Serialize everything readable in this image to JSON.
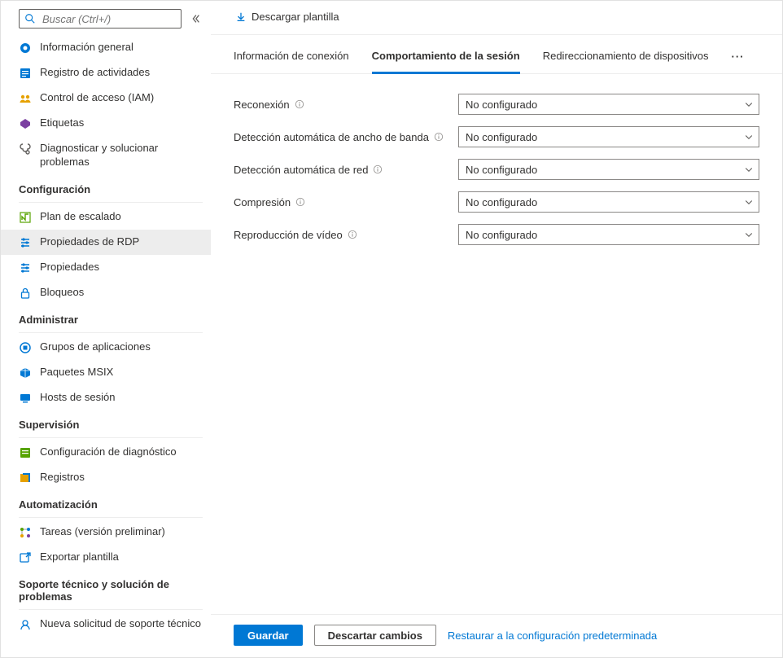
{
  "search": {
    "placeholder": "Buscar (Ctrl+/)"
  },
  "sidebar": {
    "top_items": [
      {
        "label": "Información general",
        "icon": "overview"
      },
      {
        "label": "Registro de actividades",
        "icon": "activity-log"
      },
      {
        "label": "Control de acceso (IAM)",
        "icon": "access"
      },
      {
        "label": "Etiquetas",
        "icon": "tag"
      },
      {
        "label": "Diagnosticar y solucionar problemas",
        "icon": "diagnose"
      }
    ],
    "sections": [
      {
        "title": "Configuración",
        "items": [
          {
            "label": "Plan de escalado",
            "icon": "scaling"
          },
          {
            "label": "Propiedades de RDP",
            "icon": "sliders",
            "active": true
          },
          {
            "label": "Propiedades",
            "icon": "sliders"
          },
          {
            "label": "Bloqueos",
            "icon": "lock"
          }
        ]
      },
      {
        "title": "Administrar",
        "items": [
          {
            "label": "Grupos de aplicaciones",
            "icon": "appgroup"
          },
          {
            "label": "Paquetes MSIX",
            "icon": "msix"
          },
          {
            "label": "Hosts de sesión",
            "icon": "hosts"
          }
        ]
      },
      {
        "title": "Supervisión",
        "items": [
          {
            "label": "Configuración de diagnóstico",
            "icon": "diag-settings"
          },
          {
            "label": "Registros",
            "icon": "logs"
          }
        ]
      },
      {
        "title": "Automatización",
        "items": [
          {
            "label": "Tareas (versión preliminar)",
            "icon": "tasks"
          },
          {
            "label": "Exportar plantilla",
            "icon": "export"
          }
        ]
      },
      {
        "title": "Soporte técnico y solución de problemas",
        "items": [
          {
            "label": "Nueva solicitud de soporte técnico",
            "icon": "support"
          }
        ]
      }
    ]
  },
  "toolbar": {
    "download_template": "Descargar plantilla"
  },
  "tabs": {
    "conn": "Información de conexión",
    "session": "Comportamiento de la sesión",
    "redir": "Redireccionamiento de dispositivos"
  },
  "form": {
    "rows": [
      {
        "label": "Reconexión",
        "value": "No configurado"
      },
      {
        "label": "Detección automática de ancho de banda",
        "value": "No configurado"
      },
      {
        "label": "Detección automática de red",
        "value": "No configurado"
      },
      {
        "label": "Compresión",
        "value": "No configurado"
      },
      {
        "label": "Reproducción de vídeo",
        "value": "No configurado"
      }
    ]
  },
  "footer": {
    "save": "Guardar",
    "discard": "Descartar cambios",
    "reset": "Restaurar a la configuración predeterminada"
  }
}
